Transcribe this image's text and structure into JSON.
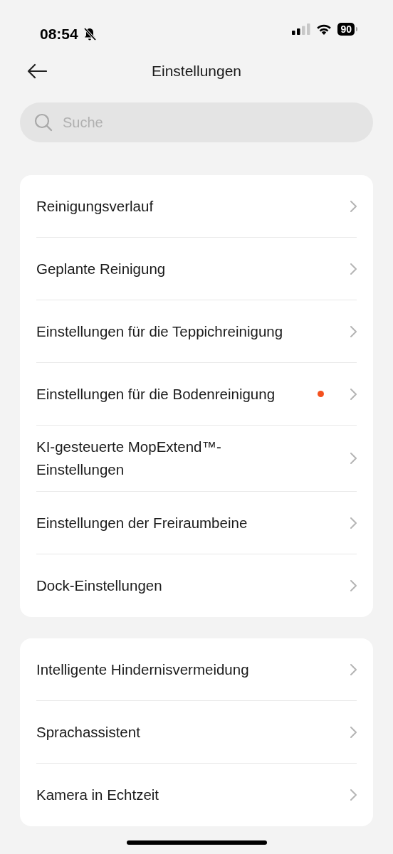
{
  "status_bar": {
    "time": "08:54",
    "muted": true,
    "battery": "90"
  },
  "header": {
    "title": "Einstellungen"
  },
  "search": {
    "placeholder": "Suche"
  },
  "groups": [
    {
      "items": [
        {
          "label": "Reinigungsverlauf",
          "dot": false
        },
        {
          "label": "Geplante Reinigung",
          "dot": false
        },
        {
          "label": "Einstellungen für die Teppichreinigung",
          "dot": false
        },
        {
          "label": "Einstellungen für die Bodenreinigung",
          "dot": true,
          "color": "#f4511e"
        },
        {
          "label": "KI-gesteuerte MopExtend™-Einstellungen",
          "dot": false
        },
        {
          "label": "Einstellungen der Freiraumbeine",
          "dot": false
        },
        {
          "label": "Dock-Einstellungen",
          "dot": false
        }
      ]
    },
    {
      "items": [
        {
          "label": "Intelligente Hindernisvermeidung",
          "dot": false
        },
        {
          "label": "Sprachassistent",
          "dot": false
        },
        {
          "label": "Kamera in Echtzeit",
          "dot": false
        }
      ]
    }
  ]
}
